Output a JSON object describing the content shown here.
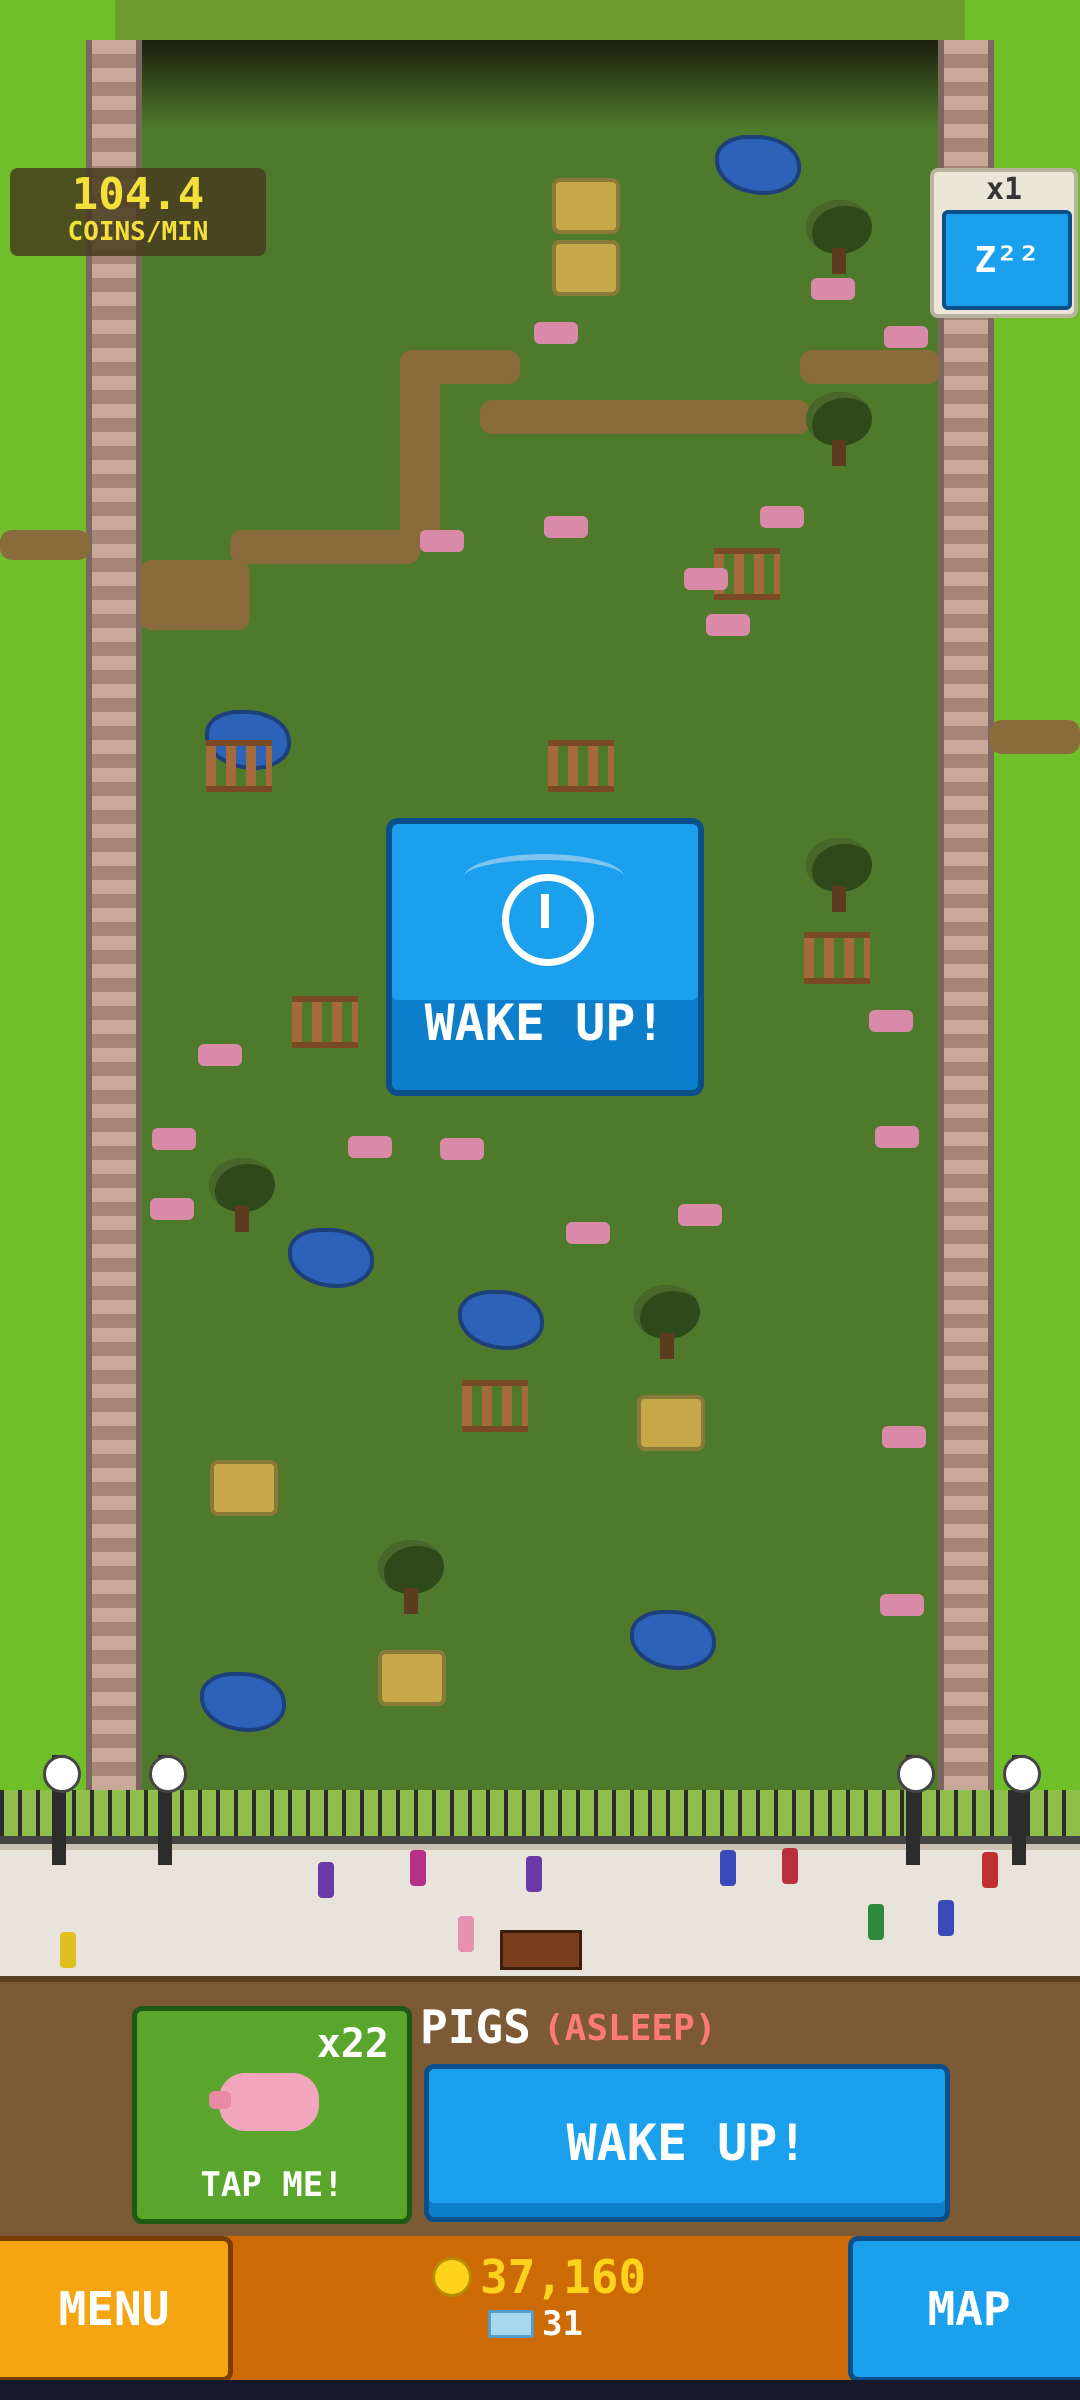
{
  "hud": {
    "rate_value": "104.4",
    "rate_unit": "COINS/MIN",
    "multiplier": "x1",
    "sleep_icon_text": "Z²²"
  },
  "center_button": {
    "label": "WAKE UP!",
    "icon": "alarm-clock-icon"
  },
  "animal_panel": {
    "count": "x22",
    "tap_label": "TAP ME!",
    "animal_name": "PIGS",
    "status": "(ASLEEP)",
    "wake_label": "WAKE UP!"
  },
  "bottom_bar": {
    "menu_label": "MENU",
    "map_label": "MAP",
    "coins": "37,160",
    "gems": "31"
  },
  "colors": {
    "accent_blue": "#1aa0ec",
    "menu_orange": "#f5a412",
    "coin_yellow": "#ffd21c",
    "asleep_red": "#ff7a72",
    "grass": "#4f7a2c"
  }
}
